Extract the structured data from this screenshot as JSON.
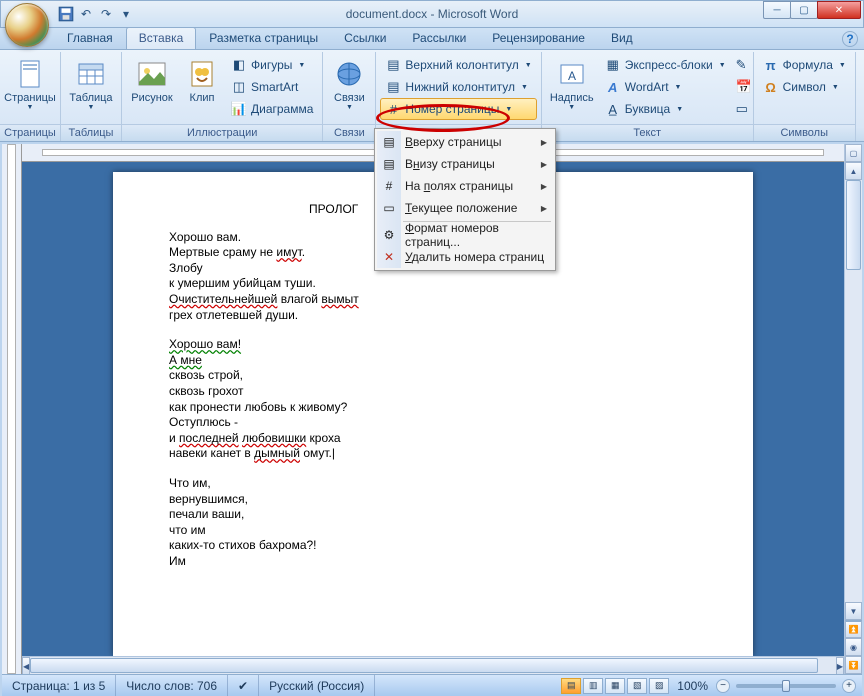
{
  "title": "document.docx - Microsoft Word",
  "qat": {
    "save": "💾",
    "undo": "↶",
    "redo": "↷"
  },
  "tabs": [
    "Главная",
    "Вставка",
    "Разметка страницы",
    "Ссылки",
    "Рассылки",
    "Рецензирование",
    "Вид"
  ],
  "ribbon": {
    "pages": {
      "label": "Страницы",
      "btn": "Страницы"
    },
    "tables": {
      "label": "Таблицы",
      "btn": "Таблица"
    },
    "illus": {
      "label": "Иллюстрации",
      "pic": "Рисунок",
      "clip": "Клип",
      "shapes": "Фигуры",
      "smart": "SmartArt",
      "chart": "Диаграмма"
    },
    "links": {
      "label": "Связи",
      "btn": "Связи"
    },
    "hf": {
      "header": "Верхний колонтитул",
      "footer": "Нижний колонтитул",
      "pagenum": "Номер страницы"
    },
    "text": {
      "label": "Текст",
      "textbox": "Надпись",
      "quick": "Экспресс-блоки",
      "wordart": "WordArt",
      "drop": "Буквица"
    },
    "sym": {
      "label": "Символы",
      "formula": "Формула",
      "symbol": "Символ"
    }
  },
  "dropdown": {
    "top": "Вверху страницы",
    "bottom": "Внизу страницы",
    "margin": "На полях страницы",
    "current": "Текущее положение",
    "format": "Формат номеров страниц...",
    "remove": "Удалить номера страниц"
  },
  "doc": {
    "heading": "ПРОЛОГ",
    "s1l1": "Хорошо вам.",
    "s1l2a": "Мертвые сраму не ",
    "s1l2b": "имут",
    "s1l2c": ".",
    "s1l3": "Злобу",
    "s1l4": "к умершим убийцам туши.",
    "s1l5a": "Очистительнейшей",
    "s1l5b": " влагой ",
    "s1l5c": "вымыт",
    "s1l6": "грех отлетевшей души.",
    "s2l1": "Хорошо  вам!",
    "s2l2": "А  мне",
    "s2l3": "сквозь строй,",
    "s2l4": "сквозь грохот",
    "s2l5": "как пронести любовь к живому?",
    "s2l6": "Оступлюсь -",
    "s2l7a": "и ",
    "s2l7b": "последней",
    "s2l7c": " ",
    "s2l7d": "любовишки",
    "s2l7e": " кроха",
    "s2l8a": "навеки канет в ",
    "s2l8b": "дымный",
    "s2l8c": " омут.",
    "s3l1": "Что им,",
    "s3l2": "вернувшимся,",
    "s3l3": "печали ваши,",
    "s3l4": "что им",
    "s3l5": "каких-то стихов бахрома?!",
    "s3l6": "Им"
  },
  "status": {
    "page": "Страница: 1 из 5",
    "words": "Число слов: 706",
    "lang": "Русский (Россия)",
    "zoom": "100%"
  }
}
